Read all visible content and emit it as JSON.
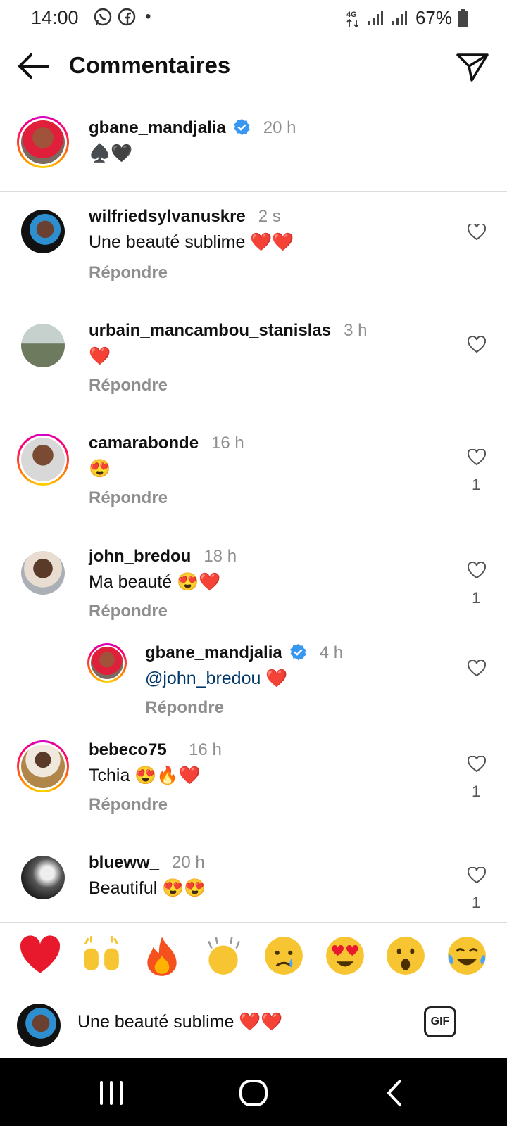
{
  "status_bar": {
    "time": "14:00",
    "network": "4G",
    "battery": "67%",
    "icons": [
      "whatsapp-icon",
      "facebook-icon",
      "notification-dot",
      "signal-icon",
      "battery-icon"
    ]
  },
  "header": {
    "title": "Commentaires",
    "back_icon": "arrow-left-icon",
    "share_icon": "paper-plane-icon"
  },
  "caption": {
    "username": "gbane_mandjalia",
    "verified": true,
    "time": "20 h",
    "text": "♠️🖤"
  },
  "comments": [
    {
      "username": "wilfriedsylvanuskre",
      "time": "2 s",
      "text": "Une beauté sublime ❤️❤️",
      "reply": "Répondre",
      "likes": ""
    },
    {
      "username": "urbain_mancambou_stanislas",
      "time": "3 h",
      "text": "❤️",
      "reply": "Répondre",
      "likes": ""
    },
    {
      "username": "camarabonde",
      "time": "16 h",
      "text": "😍",
      "reply": "Répondre",
      "likes": "1"
    },
    {
      "username": "john_bredou",
      "time": "18 h",
      "text": "Ma beauté 😍❤️",
      "reply": "Répondre",
      "likes": "1"
    },
    {
      "username": "gbane_mandjalia",
      "time": "4 h",
      "mention": "@john_bredou",
      "text": " ❤️",
      "reply": "Répondre",
      "likes": "",
      "verified": true
    },
    {
      "username": "bebeco75_",
      "time": "16 h",
      "text": "Tchia 😍🔥❤️",
      "reply": "Répondre",
      "likes": "1"
    },
    {
      "username": "blueww_",
      "time": "20 h",
      "text": "Beautiful 😍😍",
      "reply": "",
      "likes": "1"
    }
  ],
  "emoji_bar": [
    "❤️",
    "🙌",
    "🔥",
    "👏",
    "😢",
    "😍",
    "😮",
    "😂"
  ],
  "composer": {
    "text": "Une beauté sublime ❤️❤️",
    "gif_label": "GIF"
  },
  "nav": {
    "icons": [
      "recents-icon",
      "home-icon",
      "back-icon"
    ]
  },
  "colors": {
    "verified_blue": "#3897f0",
    "mention_blue": "#00376b",
    "secondary_text": "#8e8e8e"
  }
}
